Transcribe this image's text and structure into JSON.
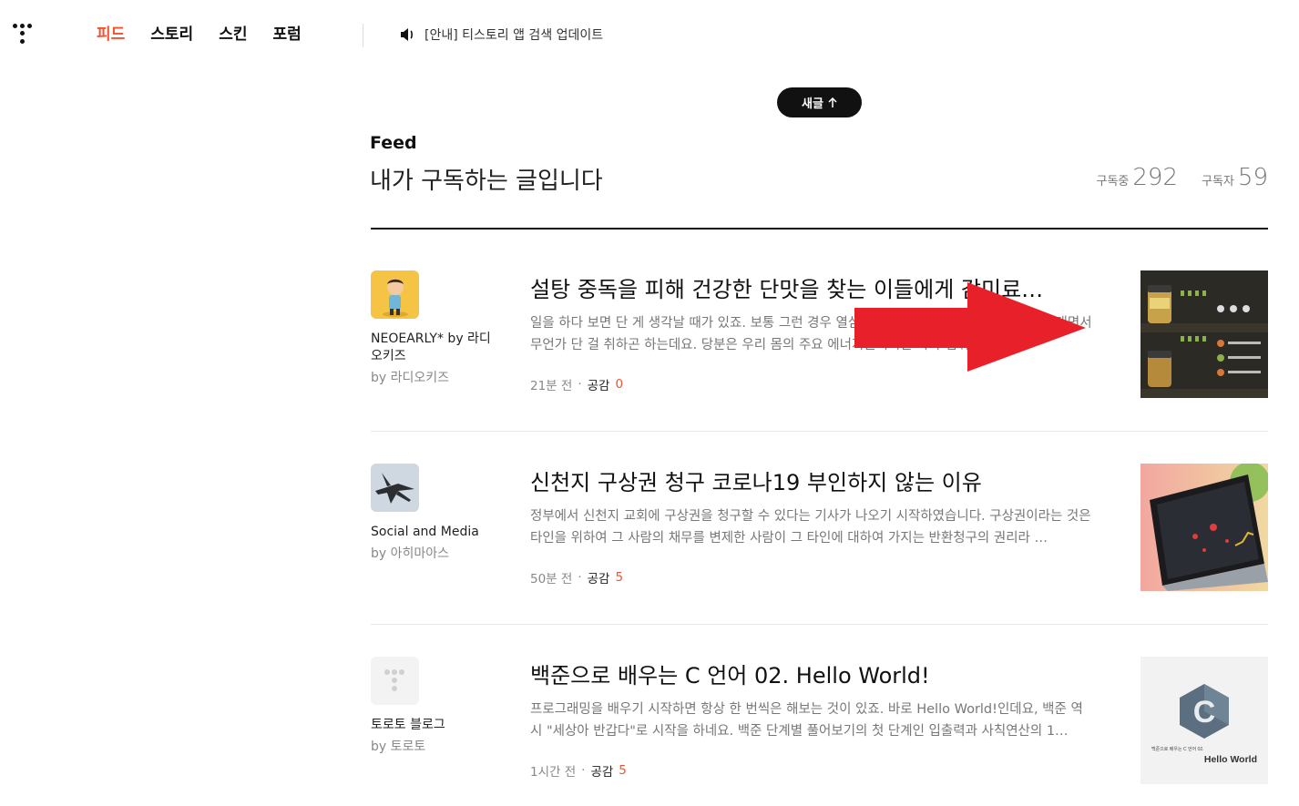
{
  "header": {
    "nav": [
      "피드",
      "스토리",
      "스킨",
      "포럼"
    ],
    "active_nav": "피드",
    "notice": "[안내] 티스토리 앱 검색 업데이트"
  },
  "new_posts_button": "새글",
  "feed": {
    "label": "Feed",
    "title": "내가 구독하는 글입니다",
    "subscribing_label": "구독중",
    "subscribing_count": "292",
    "subscribers_label": "구독자",
    "subscribers_count": "59"
  },
  "posts": [
    {
      "blog_name": "NEOEARLY* by 라디오키즈",
      "blog_by": "by 라디오키즈",
      "title": "설탕 중독을 피해 건강한 단맛을 찾는 이들에게 감미료 …",
      "summary": "일을 하다 보면 단 게 생각날 때가 있죠. 보통 그런 경우 열심히 일한 나에게 상을 준다고 핑계를 대면서 무언가 단 걸 취하곤 하는데요. 당분은 우리 몸의 주요 에너지원이지만 과다 섭취 시 비만…",
      "time": "21분 전",
      "like_label": "공감",
      "likes": "0"
    },
    {
      "blog_name": "Social and Media",
      "blog_by": "by 아히마아스",
      "title": "신천지 구상권 청구 코로나19 부인하지 않는 이유",
      "summary": "정부에서 신천지 교회에 구상권을 청구할 수 있다는 기사가 나오기 시작하였습니다. 구상권이라는 것은 타인을 위하여 그 사람의 채무를 변제한 사람이 그 타인에 대하여 가지는 반환청구의 권리라 …",
      "time": "50분 전",
      "like_label": "공감",
      "likes": "5"
    },
    {
      "blog_name": "토로토 블로그",
      "blog_by": "by 토로토",
      "title": "백준으로 배우는 C 언어 02. Hello World!",
      "summary": "프로그래밍을 배우기 시작하면 항상 한 번씩은 해보는 것이 있죠. 바로 Hello World!인데요, 백준 역시 \"세상아 반갑다\"로 시작을 하네요. 백준 단계별 풀어보기의 첫 단계인 입출력과 사칙연산의 1…",
      "time": "1시간 전",
      "like_label": "공감",
      "likes": "5",
      "thumb_caption": "백준으로 배우는 C 언어 02.",
      "thumb_title": "Hello World",
      "thumb_letter": "C"
    }
  ],
  "colors": {
    "accent": "#f1532e",
    "overlay_arrow": "#e8202a"
  }
}
